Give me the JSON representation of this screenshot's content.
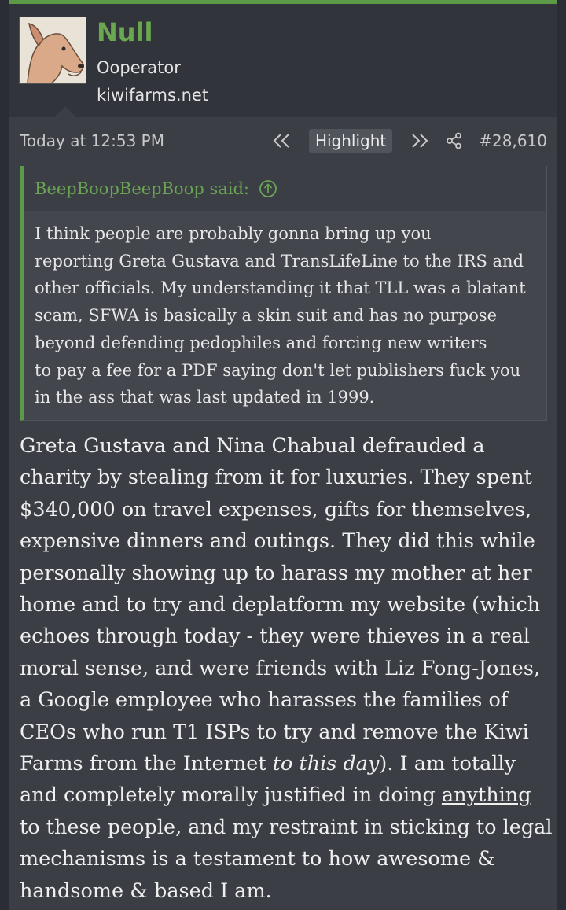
{
  "user": {
    "name": "Null",
    "title": "Ooperator",
    "site": "kiwifarms.net"
  },
  "meta": {
    "date": "Today at 12:53 PM",
    "highlight_label": "Highlight",
    "post_number": "#28,610"
  },
  "quote": {
    "attribution": "BeepBoopBeepBoop said:",
    "lines": [
      "I think people are probably gonna bring up you",
      "reporting Greta Gustava and TransLifeLine to the IRS and",
      "other officials. My understanding it that TLL was a blatant",
      "scam, SFWA is basically a skin suit and has no purpose",
      "beyond defending pedophiles and forcing new writers",
      "to pay a fee for a PDF saying don't let publishers fuck you",
      "in the ass that was last updated in 1999."
    ]
  },
  "message": {
    "lines": [
      "Greta Gustava and Nina Chabual defrauded a",
      "charity by stealing from it for luxuries. They spent",
      "$340,000 on travel expenses, gifts for themselves,",
      "expensive dinners and outings. They did this while",
      "personally showing up to harass my mother at her",
      "home and to try and deplatform my website (which",
      "echoes through today - they were thieves in a real",
      "moral sense, and were friends with Liz Fong-Jones,",
      "a Google employee who harasses the families of",
      "CEOs who run T1 ISPs to try and remove the Kiwi"
    ],
    "line11_text": "Farms from the Internet ",
    "line11_italic": "to this day",
    "line11_tail": "). I am totally",
    "line12_text": "and completely morally justified in doing ",
    "line12_underlined": "anything",
    "lines_end": [
      "to these people, and my restraint in sticking to legal",
      "mechanisms is a testament to how awesome &",
      "handsome & based I am."
    ]
  },
  "colors": {
    "accent": "#5c9a47",
    "username": "#69a84f",
    "background": "#2a2d33",
    "panel": "#3b3e44"
  },
  "icons": {
    "prev": "double-chevron-left-icon",
    "next": "double-chevron-right-icon",
    "share": "share-icon",
    "jump": "arrow-up-circle-icon"
  }
}
